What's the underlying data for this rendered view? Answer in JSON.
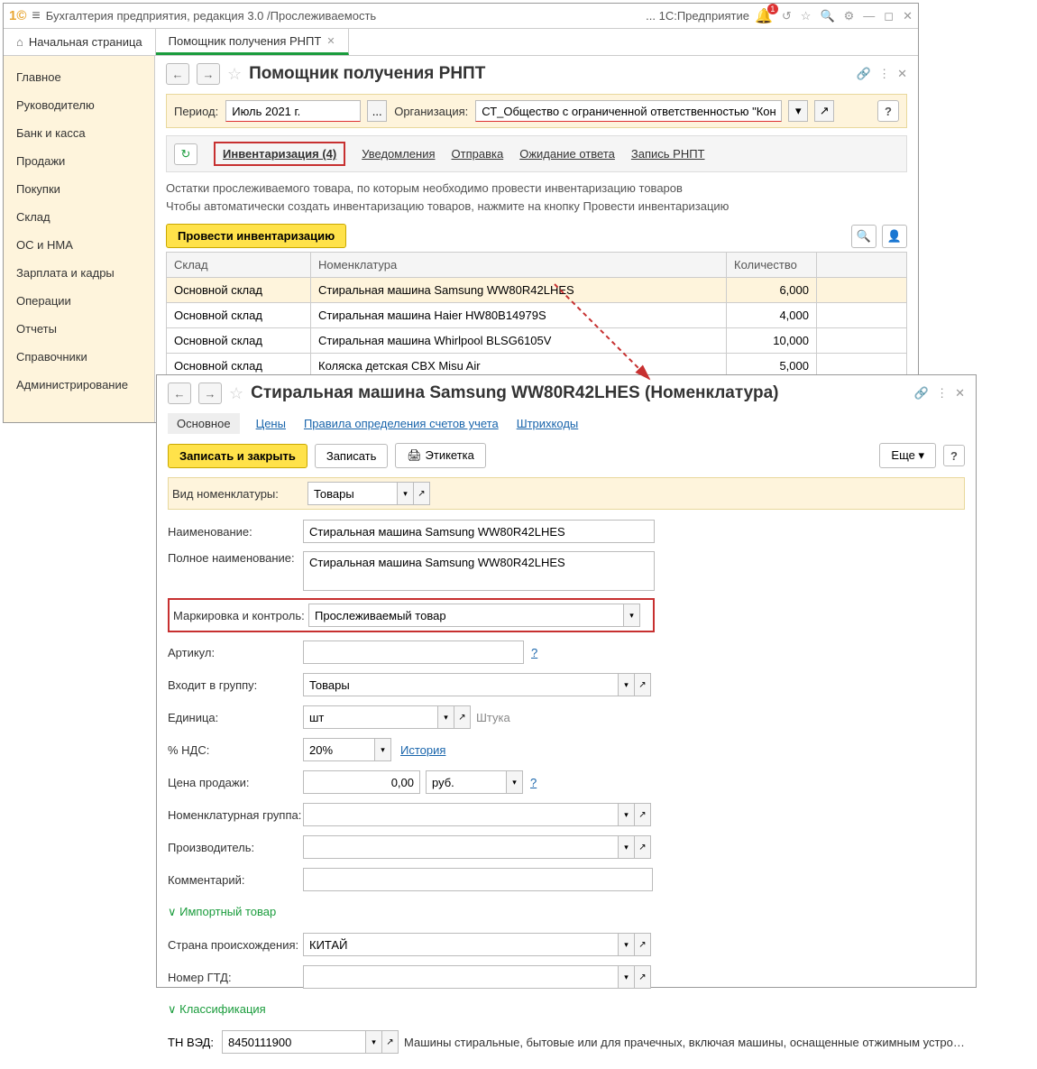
{
  "titlebar": {
    "app_title": "Бухгалтерия предприятия, редакция 3.0 /Прослеживаемость",
    "platform": "... 1С:Предприятие"
  },
  "tabs": {
    "home": "Начальная страница",
    "active": "Помощник получения РНПТ"
  },
  "sidebar": {
    "items": [
      "Главное",
      "Руководителю",
      "Банк и касса",
      "Продажи",
      "Покупки",
      "Склад",
      "ОС и НМА",
      "Зарплата и кадры",
      "Операции",
      "Отчеты",
      "Справочники",
      "Администрирование"
    ]
  },
  "page1": {
    "title": "Помощник получения РНПТ",
    "period_label": "Период:",
    "period_value": "Июль 2021 г.",
    "org_label": "Организация:",
    "org_value": "СТ_Общество с ограниченной ответственностью \"Конкорд\"",
    "tabs": [
      "Инвентаризация (4)",
      "Уведомления",
      "Отправка",
      "Ожидание ответа",
      "Запись РНПТ"
    ],
    "info1": "Остатки прослеживаемого товара, по которым необходимо провести инвентаризацию товаров",
    "info2": "Чтобы автоматически создать инвентаризацию товаров, нажмите на кнопку Провести инвентаризацию",
    "run_btn": "Провести инвентаризацию",
    "cols": {
      "warehouse": "Склад",
      "nomen": "Номенклатура",
      "qty": "Количество"
    },
    "rows": [
      {
        "w": "Основной склад",
        "n": "Стиральная машина Samsung WW80R42LHES",
        "q": "6,000"
      },
      {
        "w": "Основной склад",
        "n": "Стиральная машина Haier HW80B14979S",
        "q": "4,000"
      },
      {
        "w": "Основной склад",
        "n": "Стиральная машина Whirlpool BLSG6105V",
        "q": "10,000"
      },
      {
        "w": "Основной склад",
        "n": "Коляска детская CBX Misu Air",
        "q": "5,000"
      }
    ]
  },
  "page2": {
    "title": "Стиральная машина Samsung WW80R42LHES (Номенклатура)",
    "subtabs": [
      "Основное",
      "Цены",
      "Правила определения счетов учета",
      "Штрихкоды"
    ],
    "write_close": "Записать и закрыть",
    "write": "Записать",
    "label_btn": "Этикетка",
    "more": "Еще",
    "fields": {
      "type_label": "Вид номенклатуры:",
      "type_value": "Товары",
      "name_label": "Наименование:",
      "name_value": "Стиральная машина Samsung WW80R42LHES",
      "fullname_label": "Полное наименование:",
      "fullname_value": "Стиральная машина Samsung WW80R42LHES",
      "mark_label": "Маркировка и контроль:",
      "mark_value": "Прослеживаемый товар",
      "article_label": "Артикул:",
      "group_label": "Входит в группу:",
      "group_value": "Товары",
      "unit_label": "Единица:",
      "unit_value": "шт",
      "unit_hint": "Штука",
      "vat_label": "% НДС:",
      "vat_value": "20%",
      "vat_link": "История",
      "price_label": "Цена продажи:",
      "price_value": "0,00",
      "currency": "руб.",
      "nomgroup_label": "Номенклатурная группа:",
      "manuf_label": "Производитель:",
      "comment_label": "Комментарий:",
      "import_section": "Импортный товар",
      "country_label": "Страна происхождения:",
      "country_value": "КИТАЙ",
      "gtd_label": "Номер ГТД:",
      "class_section": "Классификация",
      "tnved_label": "ТН ВЭД:",
      "tnved_value": "8450111900",
      "tnved_hint": "Машины стиральные, бытовые или для прачечных, включая машины, оснащенные отжимным устройством..."
    }
  }
}
